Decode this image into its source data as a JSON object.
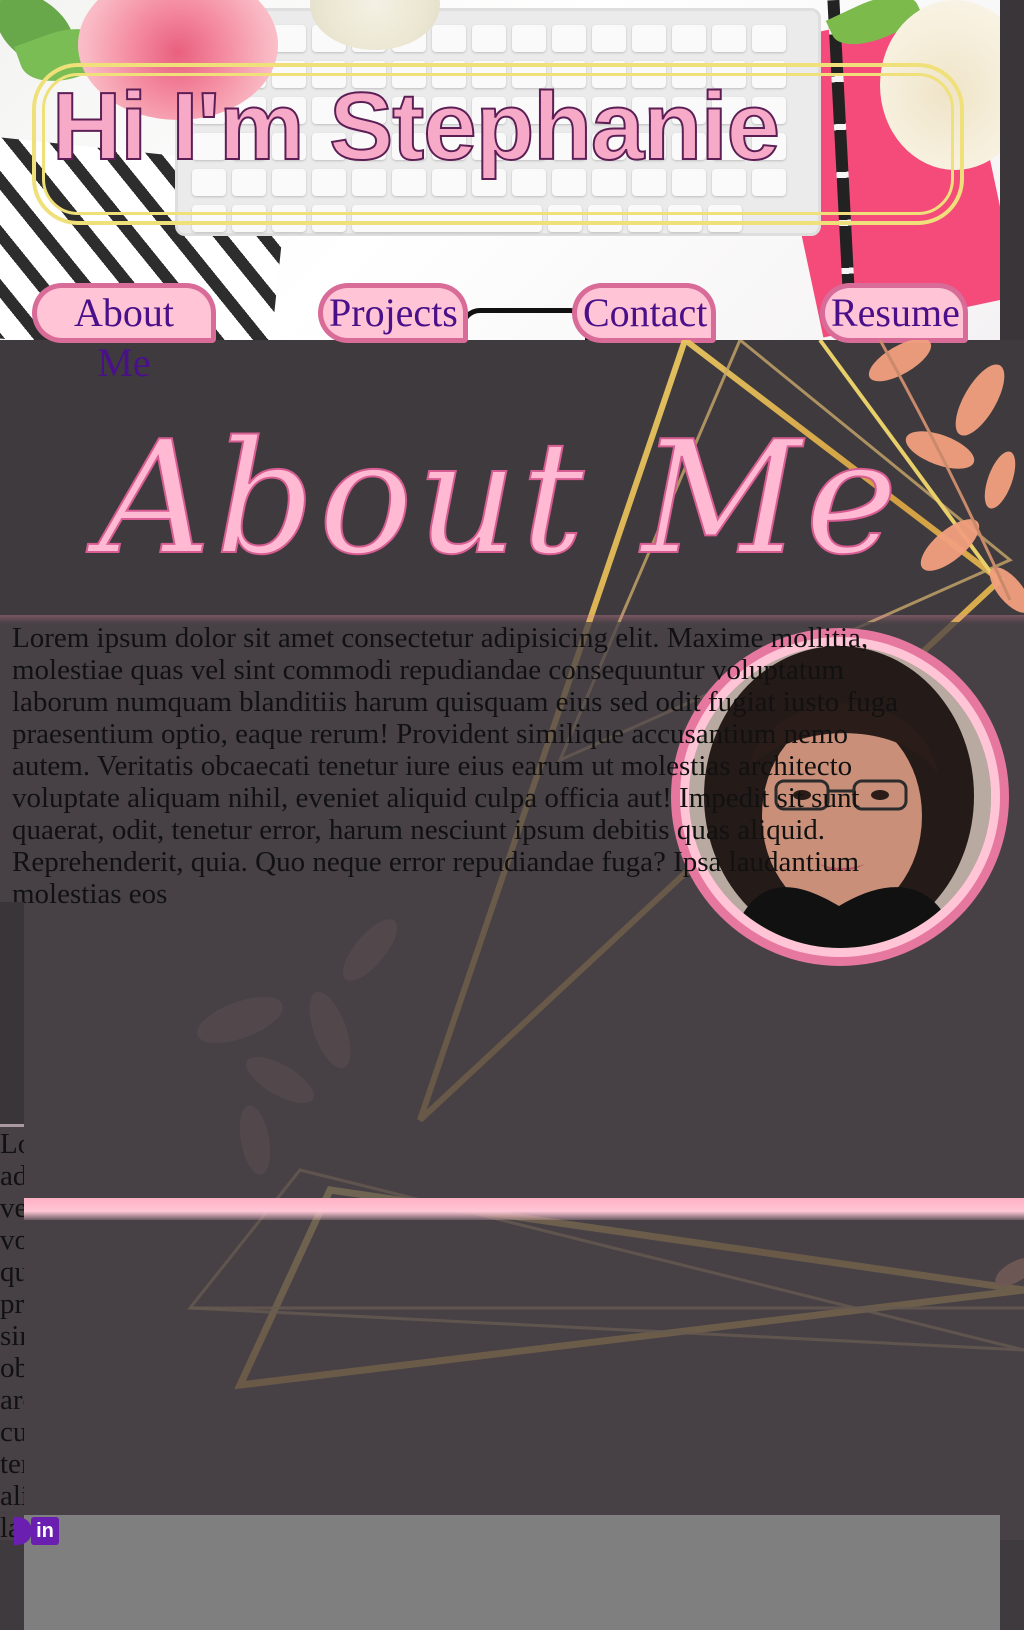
{
  "header": {
    "title": "Hi I'm Stephanie"
  },
  "nav": {
    "items": [
      {
        "label": "About Me"
      },
      {
        "label": "Projects"
      },
      {
        "label": "Contact"
      },
      {
        "label": "Resume"
      }
    ]
  },
  "about": {
    "heading": "About Me",
    "body": "Lorem ipsum dolor sit amet consectetur adipisicing elit. Maxime mollitia, molestiae quas vel sint commodi repudiandae consequuntur voluptatum laborum numquam blanditiis harum quisquam eius sed odit fugiat iusto fuga praesentium optio, eaque rerum! Provident similique accusantium nemo autem. Veritatis obcaecati tenetur iure eius earum ut molestias architecto voluptate aliquam nihil, eveniet aliquid culpa officia aut! Impedit sit sunt quaerat, odit, tenetur error, harum nesciunt ipsum debitis quas aliquid. Reprehenderit, quia. Quo neque error repudiandae fuga? Ipsa laudantium molestias eos",
    "clipped_lines": [
      "Lo",
      "adi",
      "vel",
      "vol",
      "qui",
      "pra",
      "sin",
      "obc",
      "arc",
      "cul",
      "ten",
      "ali",
      "lau"
    ]
  },
  "social": {
    "linkedin_icon": "linkedin-icon",
    "linkedin_text": "in",
    "github_icon": "github-icon"
  },
  "colors": {
    "accent_pink": "#ffc4d6",
    "nav_border": "#d96b98",
    "nav_text": "#4a108a",
    "frame_gold": "#efe07a",
    "background": "#3e3a3d"
  }
}
